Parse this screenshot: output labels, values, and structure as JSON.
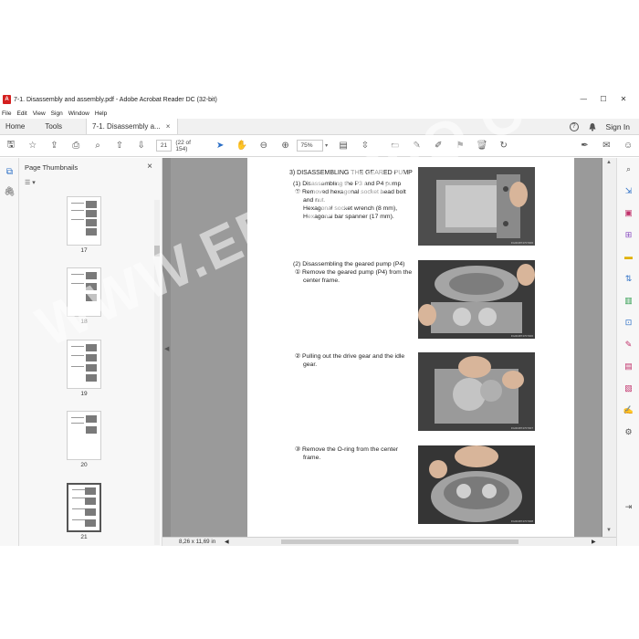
{
  "window": {
    "title": "7-1. Disassembly and assembly.pdf - Adobe Acrobat Reader DC (32-bit)",
    "min": "—",
    "max": "☐",
    "close": "✕"
  },
  "menu": [
    "File",
    "Edit",
    "View",
    "Sign",
    "Window",
    "Help"
  ],
  "tabs": {
    "home": "Home",
    "tools": "Tools",
    "doc": "7-1. Disassembly a...",
    "doc_close": "×",
    "help": "?",
    "bell": "🔔",
    "signin": "Sign In"
  },
  "toolbar": {
    "page_number": "21",
    "page_total": "(22 of 154)",
    "zoom": "75%"
  },
  "thumbnails": {
    "title": "Page Thumbnails",
    "close": "×",
    "options": "☰ ▾",
    "pages": [
      "17",
      "18",
      "19",
      "20",
      "21"
    ]
  },
  "document": {
    "heading": "3) DISASSEMBLING THE GEARED PUMP",
    "step1_title": "(1) Disassembling the P3 and P4 pump",
    "step1_line1": "① Removed hexagonal socket head bolt",
    "step1_line2": "and nut.",
    "step1_line3": "Hexagonal socket wrench (8 mm),",
    "step1_line4": "Hexagonal bar spanner (17 mm).",
    "step2_title": "(2) Disassembling the geared pump (P4)",
    "step2_line1": "① Remove the geared pump (P4) from the",
    "step2_line2": "center frame.",
    "step3_line1": "② Pulling out the drive gear and the idle",
    "step3_line2": "gear.",
    "step4_line1": "③ Remove the O-ring from the center",
    "step4_line2": "frame.",
    "photo_captions": [
      "FG004874707006",
      "FG004874707006",
      "FG004874707007",
      "FG004874707008"
    ]
  },
  "status": {
    "page_size": "8,26 x 11,69 in"
  },
  "watermark": "WWW.EPCDEPO.COM"
}
